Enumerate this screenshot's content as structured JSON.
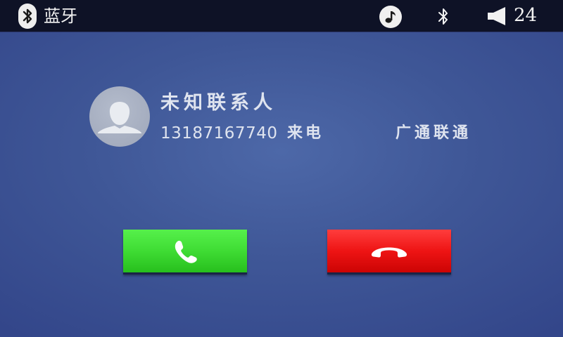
{
  "statusbar": {
    "app_icon": "bluetooth-icon",
    "title": "蓝牙",
    "music_icon": "music-note-icon",
    "bluetooth_icon": "bluetooth-icon",
    "volume_icon": "speaker-icon",
    "volume_level": "24"
  },
  "call": {
    "avatar_icon": "contact-avatar-icon",
    "contact_name": "未知联系人",
    "phone_number": "13187167740",
    "status": "来电",
    "carrier": "广通联通"
  },
  "actions": {
    "answer_icon": "phone-answer-icon",
    "hangup_icon": "phone-hangup-icon"
  },
  "colors": {
    "answer": "#3fdc34",
    "hangup": "#ee1414",
    "background": "#3f5797",
    "statusbar": "#0e1226"
  }
}
